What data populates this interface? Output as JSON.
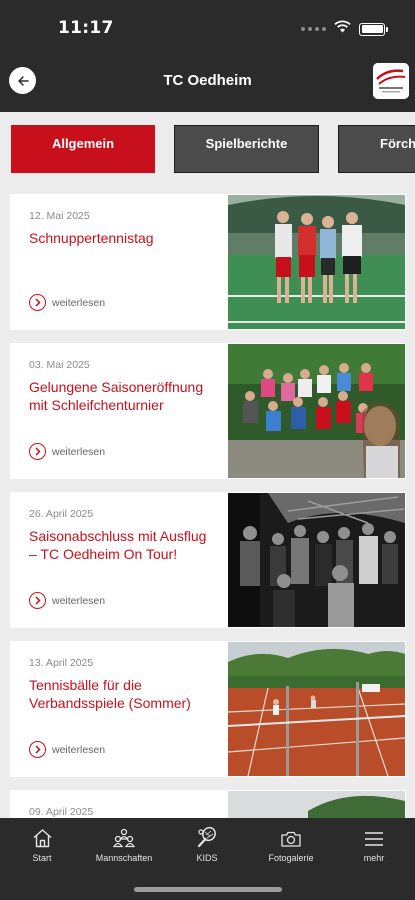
{
  "status_bar": {
    "time": "11:17"
  },
  "header": {
    "title": "TC Oedheim"
  },
  "tabs": [
    {
      "label": "Allgemein",
      "active": true
    },
    {
      "label": "Spielberichte",
      "active": false
    },
    {
      "label": "Förch",
      "active": false
    }
  ],
  "articles": [
    {
      "date": "12. Mai 2025",
      "title": "Schnuppertennistag",
      "more": "weiterlesen"
    },
    {
      "date": "03. Mai 2025",
      "title": "Gelungene Saisoneröffnung mit Schleifchenturnier",
      "more": "weiterlesen"
    },
    {
      "date": "26. April 2025",
      "title": "Saisonabschluss mit Ausflug – TC Oedheim On Tour!",
      "more": "weiterlesen"
    },
    {
      "date": "13. April 2025",
      "title": "Tennisbälle für die Verbandsspiele (Sommer)",
      "more": "weiterlesen"
    },
    {
      "date": "09. April 2025",
      "title": "",
      "more": ""
    }
  ],
  "bottom_nav": [
    {
      "label": "Start",
      "icon": "home-icon"
    },
    {
      "label": "Mannschaften",
      "icon": "team-icon"
    },
    {
      "label": "KIDS",
      "icon": "tennis-racket-icon"
    },
    {
      "label": "Fotogalerie",
      "icon": "camera-icon"
    },
    {
      "label": "mehr",
      "icon": "menu-icon"
    }
  ],
  "colors": {
    "accent": "#c8101d",
    "bar": "#2b2b2b",
    "background": "#ececec",
    "tab_inactive": "#4b4b4b"
  }
}
